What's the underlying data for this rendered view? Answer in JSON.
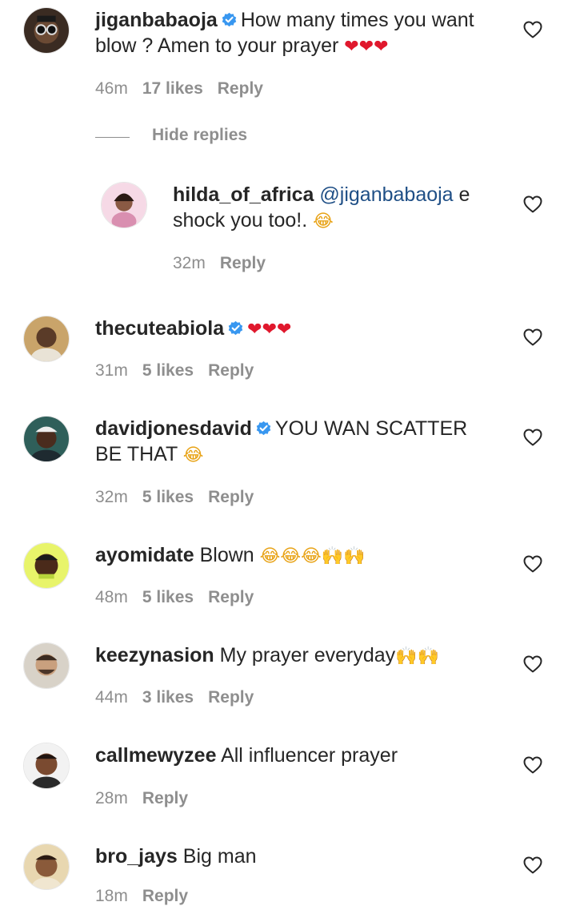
{
  "icons": {
    "verified": "verified-badge-icon",
    "like": "heart-outline-icon",
    "heart_emoji": "❤",
    "laugh_emoji": "😂",
    "hands_emoji": "🙌"
  },
  "colors": {
    "text": "#262626",
    "muted": "#8e8e8e",
    "verified": "#3897f0",
    "mention": "#1f4f86"
  },
  "hide_replies": "Hide replies",
  "comments": [
    {
      "username": "jiganbabaoja",
      "verified": true,
      "text": "How many times you want blow ? Amen to your prayer",
      "time": "46m",
      "likes": "17 likes",
      "reply": "Reply"
    },
    {
      "username": "hilda_of_africa",
      "mention": "@jiganbabaoja",
      "text": "e shock you too!.",
      "time": "32m",
      "reply": "Reply"
    },
    {
      "username": "thecuteabiola",
      "verified": true,
      "text": "",
      "time": "31m",
      "likes": "5 likes",
      "reply": "Reply"
    },
    {
      "username": "davidjonesdavid",
      "verified": true,
      "text": "YOU WAN SCATTER BE THAT",
      "time": "32m",
      "likes": "5 likes",
      "reply": "Reply"
    },
    {
      "username": "ayomidate",
      "text": "Blown",
      "time": "48m",
      "likes": "5 likes",
      "reply": "Reply"
    },
    {
      "username": "keezynasion",
      "text": "My prayer everyday",
      "time": "44m",
      "likes": "3 likes",
      "reply": "Reply"
    },
    {
      "username": "callmewyzee",
      "text": "All influencer prayer",
      "time": "28m",
      "reply": "Reply"
    },
    {
      "username": "bro_jays",
      "text": "Big man",
      "time": "18m",
      "reply": "Reply"
    }
  ]
}
